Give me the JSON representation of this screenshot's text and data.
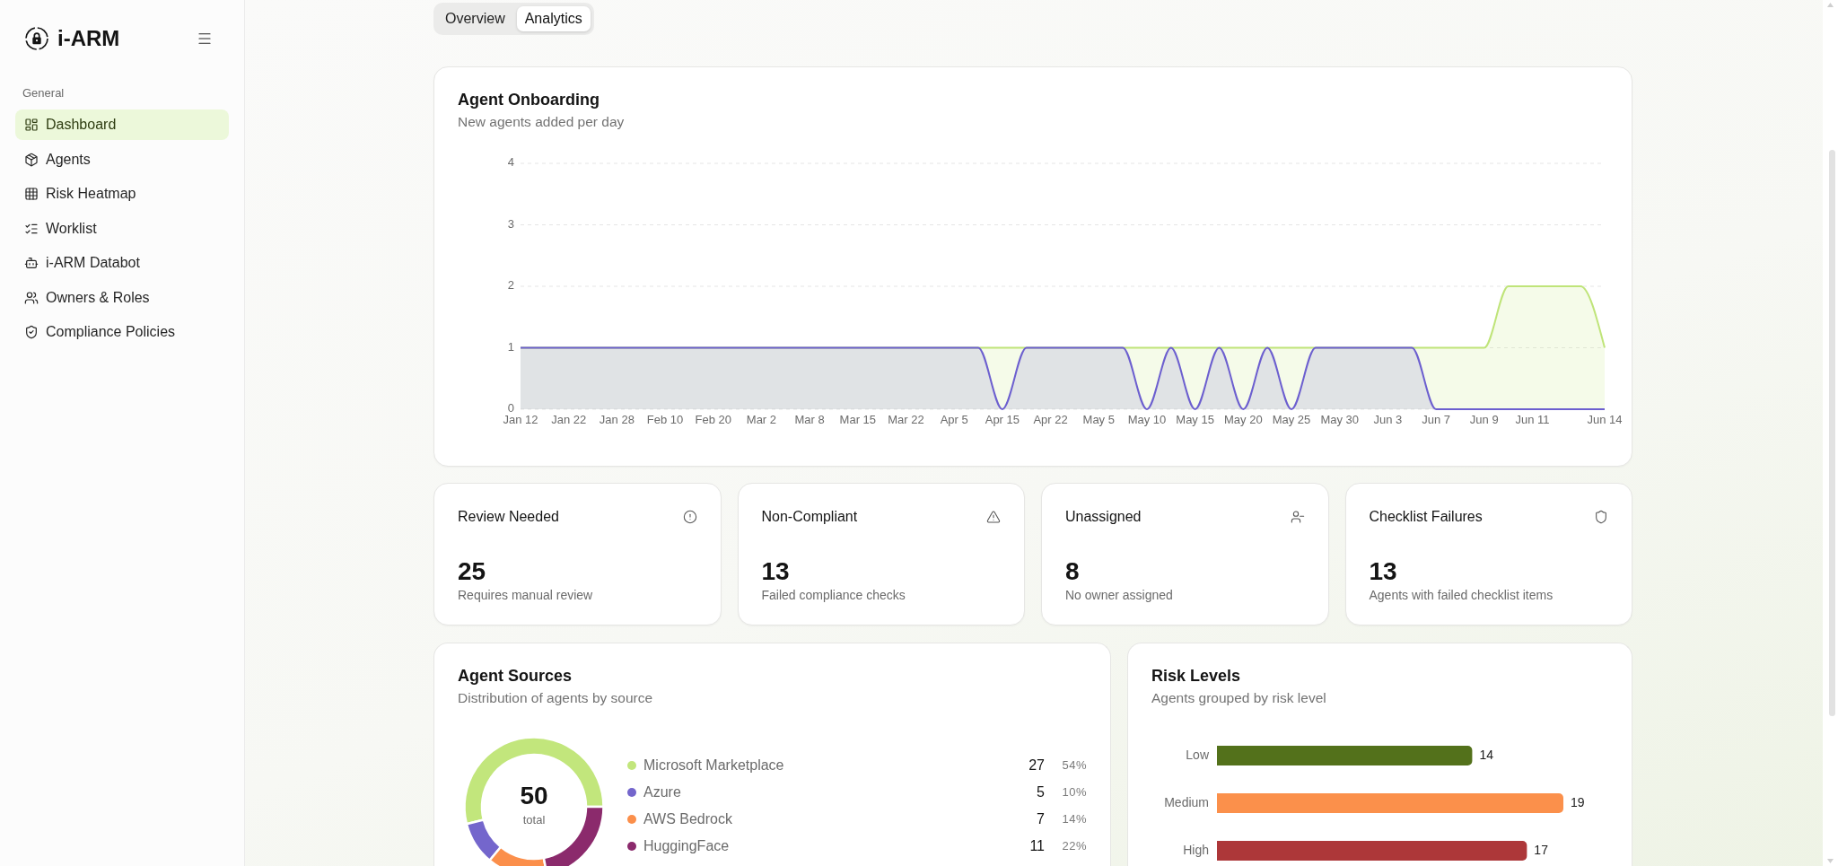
{
  "sidebar": {
    "brand": "i-ARM",
    "section_label": "General",
    "items": [
      {
        "label": "Dashboard",
        "selected": true
      },
      {
        "label": "Agents",
        "selected": false
      },
      {
        "label": "Risk Heatmap",
        "selected": false
      },
      {
        "label": "Worklist",
        "selected": false
      },
      {
        "label": "i-ARM Databot",
        "selected": false
      },
      {
        "label": "Owners & Roles",
        "selected": false
      },
      {
        "label": "Compliance Policies",
        "selected": false
      }
    ]
  },
  "tabs": [
    {
      "label": "Overview",
      "selected": false
    },
    {
      "label": "Analytics",
      "selected": true
    }
  ],
  "onboarding_card": {
    "title": "Agent Onboarding",
    "subtitle": "New agents added per day",
    "chart_data": {
      "type": "area",
      "stacked": false,
      "grid": true,
      "categories": [
        "Jan 12",
        null,
        "Jan 22",
        null,
        "Jan 28",
        null,
        "Feb 10",
        null,
        "Feb 20",
        null,
        "Mar 2",
        null,
        "Mar 8",
        null,
        "Mar 15",
        null,
        "Mar 22",
        null,
        "Apr 5",
        null,
        "Apr 15",
        null,
        "Apr 22",
        null,
        "May 5",
        null,
        "May 10",
        null,
        "May 15",
        null,
        "May 20",
        null,
        "May 25",
        null,
        "May 30",
        null,
        "Jun 3",
        null,
        "Jun 7",
        null,
        "Jun 9",
        null,
        "Jun 11",
        null,
        null,
        "Jun 14"
      ],
      "ylim": [
        0,
        4
      ],
      "yticks": [
        0,
        1,
        2,
        3,
        4
      ],
      "series": [
        {
          "color": "#bfe479",
          "values": [
            1,
            1,
            1,
            1,
            1,
            1,
            1,
            1,
            1,
            1,
            1,
            1,
            1,
            1,
            1,
            1,
            1,
            1,
            1,
            1,
            1,
            1,
            1,
            1,
            1,
            1,
            1,
            1,
            1,
            1,
            1,
            1,
            1,
            1,
            1,
            1,
            1,
            1,
            1,
            1,
            1,
            2,
            2,
            2,
            2,
            1
          ]
        },
        {
          "color": "#6c5fcf",
          "values": [
            1,
            1,
            1,
            1,
            1,
            1,
            1,
            1,
            1,
            1,
            1,
            1,
            1,
            1,
            1,
            1,
            1,
            1,
            1,
            1,
            0,
            1,
            1,
            1,
            1,
            1,
            0,
            1,
            0,
            1,
            0,
            1,
            0,
            1,
            1,
            1,
            1,
            1,
            0,
            0,
            0,
            0,
            0,
            0,
            0,
            0
          ]
        }
      ]
    }
  },
  "stat_cards": [
    {
      "title": "Review Needed",
      "value": "25",
      "description": "Requires manual review"
    },
    {
      "title": "Non-Compliant",
      "value": "13",
      "description": "Failed compliance checks"
    },
    {
      "title": "Unassigned",
      "value": "8",
      "description": "No owner assigned"
    },
    {
      "title": "Checklist Failures",
      "value": "13",
      "description": "Agents with failed checklist items"
    }
  ],
  "agent_sources": {
    "title": "Agent Sources",
    "subtitle": "Distribution of agents by source",
    "total": "50",
    "total_label": "total",
    "chart_data": {
      "type": "donut",
      "values": [
        54,
        10,
        14,
        22
      ]
    },
    "legend": [
      {
        "name": "Microsoft Marketplace",
        "count": "27",
        "percent": "54%",
        "color": "#c2e67c"
      },
      {
        "name": "Azure",
        "count": "5",
        "percent": "10%",
        "color": "#7466cc"
      },
      {
        "name": "AWS Bedrock",
        "count": "7",
        "percent": "14%",
        "color": "#fb8f4b"
      },
      {
        "name": "HuggingFace",
        "count": "11",
        "percent": "22%",
        "color": "#8b2a6c"
      }
    ]
  },
  "risk_levels": {
    "title": "Risk Levels",
    "subtitle": "Agents grouped by risk level",
    "chart_data": {
      "type": "bar",
      "orientation": "horizontal",
      "categories": [
        "Low",
        "Medium",
        "High"
      ],
      "values": [
        14,
        19,
        17
      ],
      "colors": [
        "#53711b",
        "#fb904b",
        "#ad3739"
      ],
      "data_labels": true
    }
  }
}
